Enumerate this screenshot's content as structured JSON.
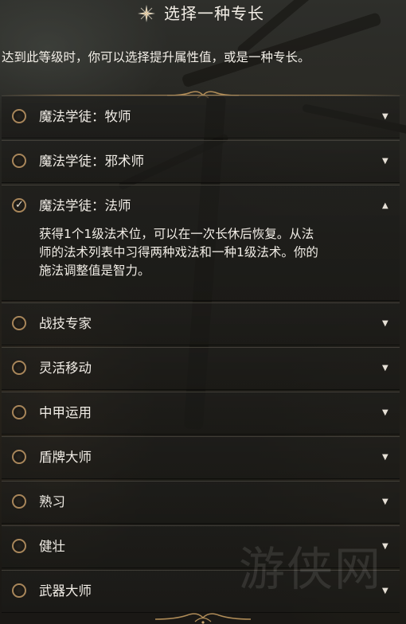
{
  "header": {
    "title": "选择一种专长",
    "star_icon": "sparkle-star-icon"
  },
  "intro_text": "达到此等级时，你可以选择提升属性值，或是一种专长。",
  "feats": [
    {
      "label": "魔法学徒：牧师",
      "selected": false,
      "expanded": false
    },
    {
      "label": "魔法学徒：邪术师",
      "selected": false,
      "expanded": false
    },
    {
      "label": "魔法学徒：法师",
      "selected": true,
      "expanded": true,
      "description": [
        "获得1个1级法术位，可以在一次长休后恢复。从法",
        "师的法术列表中习得两种戏法和一种1级法术。你的",
        "施法调整值是智力。"
      ]
    },
    {
      "label": "战技专家",
      "selected": false,
      "expanded": false
    },
    {
      "label": "灵活移动",
      "selected": false,
      "expanded": false
    },
    {
      "label": "中甲运用",
      "selected": false,
      "expanded": false
    },
    {
      "label": "盾牌大师",
      "selected": false,
      "expanded": false
    },
    {
      "label": "熟习",
      "selected": false,
      "expanded": false
    },
    {
      "label": "健壮",
      "selected": false,
      "expanded": false
    },
    {
      "label": "武器大师",
      "selected": false,
      "expanded": false
    }
  ],
  "icons": {
    "check": "✓",
    "caret_down": "▼",
    "caret_up": "▲"
  },
  "watermark_text": "游侠网",
  "colors": {
    "accent_gold": "#a8865a",
    "text": "#f1ede6"
  }
}
